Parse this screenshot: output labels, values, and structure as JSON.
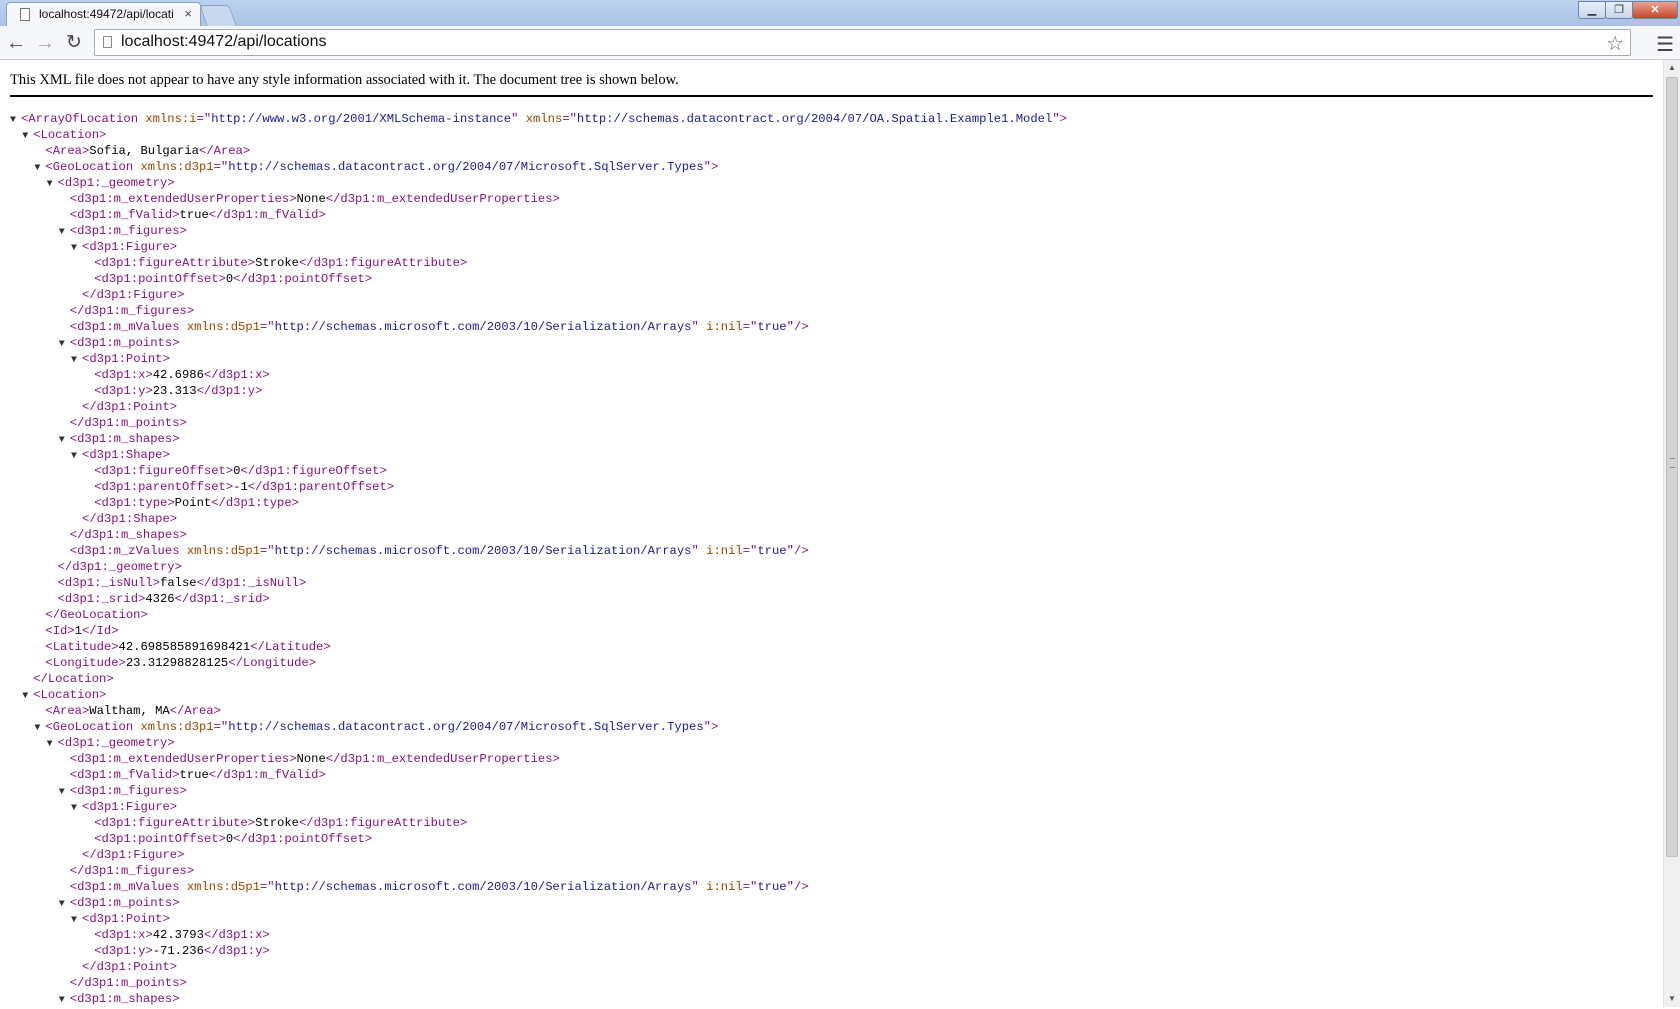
{
  "browser": {
    "tab_title": "localhost:49472/api/locati",
    "tab_close": "×",
    "url": "localhost:49472/api/locations",
    "win_minimize": "▁",
    "win_maximize": "❐",
    "win_close": "✕"
  },
  "content": {
    "info_text": "This XML file does not appear to have any style information associated with it. The document tree is shown below."
  },
  "xml": {
    "rows": [
      {
        "t": "▼",
        "s": [
          [
            "tg",
            "<ArrayOfLocation"
          ],
          [
            "an",
            " xmlns:i"
          ],
          [
            "tg",
            "=\""
          ],
          [
            "av",
            "http://www.w3.org/2001/XMLSchema-instance"
          ],
          [
            "tg",
            "\""
          ],
          [
            "an",
            " xmlns"
          ],
          [
            "tg",
            "=\""
          ],
          [
            "av",
            "http://schemas.datacontract.org/2004/07/OA.Spatial.Example1.Model"
          ],
          [
            "tg",
            "\">"
          ]
        ]
      },
      {
        "t": "▼",
        "s": [
          [
            "tg",
            "<Location>"
          ]
        ]
      },
      {
        "t": "",
        "s": [
          [
            "tg",
            "<Area>"
          ],
          [
            "tx",
            "Sofia, Bulgaria"
          ],
          [
            "tg",
            "</Area>"
          ]
        ]
      },
      {
        "t": "▼",
        "s": [
          [
            "tg",
            "<GeoLocation"
          ],
          [
            "an",
            " xmlns:d3p1"
          ],
          [
            "tg",
            "=\""
          ],
          [
            "av",
            "http://schemas.datacontract.org/2004/07/Microsoft.SqlServer.Types"
          ],
          [
            "tg",
            "\">"
          ]
        ]
      },
      {
        "t": "▼",
        "s": [
          [
            "tg",
            "<d3p1:_geometry>"
          ]
        ]
      },
      {
        "t": "",
        "s": [
          [
            "tg",
            "<d3p1:m_extendedUserProperties>"
          ],
          [
            "tx",
            "None"
          ],
          [
            "tg",
            "</d3p1:m_extendedUserProperties>"
          ]
        ]
      },
      {
        "t": "",
        "s": [
          [
            "tg",
            "<d3p1:m_fValid>"
          ],
          [
            "tx",
            "true"
          ],
          [
            "tg",
            "</d3p1:m_fValid>"
          ]
        ]
      },
      {
        "t": "▼",
        "s": [
          [
            "tg",
            "<d3p1:m_figures>"
          ]
        ]
      },
      {
        "t": "▼",
        "s": [
          [
            "tg",
            "<d3p1:Figure>"
          ]
        ]
      },
      {
        "t": "",
        "s": [
          [
            "tg",
            "<d3p1:figureAttribute>"
          ],
          [
            "tx",
            "Stroke"
          ],
          [
            "tg",
            "</d3p1:figureAttribute>"
          ]
        ]
      },
      {
        "t": "",
        "s": [
          [
            "tg",
            "<d3p1:pointOffset>"
          ],
          [
            "tx",
            "0"
          ],
          [
            "tg",
            "</d3p1:pointOffset>"
          ]
        ]
      },
      {
        "t": "",
        "s": [
          [
            "tg",
            "</d3p1:Figure>"
          ]
        ]
      },
      {
        "t": "",
        "s": [
          [
            "tg",
            "</d3p1:m_figures>"
          ]
        ]
      },
      {
        "t": "",
        "s": [
          [
            "tg",
            "<d3p1:m_mValues"
          ],
          [
            "an",
            " xmlns:d5p1"
          ],
          [
            "tg",
            "=\""
          ],
          [
            "av",
            "http://schemas.microsoft.com/2003/10/Serialization/Arrays"
          ],
          [
            "tg",
            "\""
          ],
          [
            "an",
            " i:nil"
          ],
          [
            "tg",
            "=\""
          ],
          [
            "av",
            "true"
          ],
          [
            "tg",
            "\"/>"
          ]
        ]
      },
      {
        "t": "▼",
        "s": [
          [
            "tg",
            "<d3p1:m_points>"
          ]
        ]
      },
      {
        "t": "▼",
        "s": [
          [
            "tg",
            "<d3p1:Point>"
          ]
        ]
      },
      {
        "t": "",
        "s": [
          [
            "tg",
            "<d3p1:x>"
          ],
          [
            "tx",
            "42.6986"
          ],
          [
            "tg",
            "</d3p1:x>"
          ]
        ]
      },
      {
        "t": "",
        "s": [
          [
            "tg",
            "<d3p1:y>"
          ],
          [
            "tx",
            "23.313"
          ],
          [
            "tg",
            "</d3p1:y>"
          ]
        ]
      },
      {
        "t": "",
        "s": [
          [
            "tg",
            "</d3p1:Point>"
          ]
        ]
      },
      {
        "t": "",
        "s": [
          [
            "tg",
            "</d3p1:m_points>"
          ]
        ]
      },
      {
        "t": "▼",
        "s": [
          [
            "tg",
            "<d3p1:m_shapes>"
          ]
        ]
      },
      {
        "t": "▼",
        "s": [
          [
            "tg",
            "<d3p1:Shape>"
          ]
        ]
      },
      {
        "t": "",
        "s": [
          [
            "tg",
            "<d3p1:figureOffset>"
          ],
          [
            "tx",
            "0"
          ],
          [
            "tg",
            "</d3p1:figureOffset>"
          ]
        ]
      },
      {
        "t": "",
        "s": [
          [
            "tg",
            "<d3p1:parentOffset>"
          ],
          [
            "tx",
            "-1"
          ],
          [
            "tg",
            "</d3p1:parentOffset>"
          ]
        ]
      },
      {
        "t": "",
        "s": [
          [
            "tg",
            "<d3p1:type>"
          ],
          [
            "tx",
            "Point"
          ],
          [
            "tg",
            "</d3p1:type>"
          ]
        ]
      },
      {
        "t": "",
        "s": [
          [
            "tg",
            "</d3p1:Shape>"
          ]
        ]
      },
      {
        "t": "",
        "s": [
          [
            "tg",
            "</d3p1:m_shapes>"
          ]
        ]
      },
      {
        "t": "",
        "s": [
          [
            "tg",
            "<d3p1:m_zValues"
          ],
          [
            "an",
            " xmlns:d5p1"
          ],
          [
            "tg",
            "=\""
          ],
          [
            "av",
            "http://schemas.microsoft.com/2003/10/Serialization/Arrays"
          ],
          [
            "tg",
            "\""
          ],
          [
            "an",
            " i:nil"
          ],
          [
            "tg",
            "=\""
          ],
          [
            "av",
            "true"
          ],
          [
            "tg",
            "\"/>"
          ]
        ]
      },
      {
        "t": "",
        "s": [
          [
            "tg",
            "</d3p1:_geometry>"
          ]
        ]
      },
      {
        "t": "",
        "s": [
          [
            "tg",
            "<d3p1:_isNull>"
          ],
          [
            "tx",
            "false"
          ],
          [
            "tg",
            "</d3p1:_isNull>"
          ]
        ]
      },
      {
        "t": "",
        "s": [
          [
            "tg",
            "<d3p1:_srid>"
          ],
          [
            "tx",
            "4326"
          ],
          [
            "tg",
            "</d3p1:_srid>"
          ]
        ]
      },
      {
        "t": "",
        "s": [
          [
            "tg",
            "</GeoLocation>"
          ]
        ]
      },
      {
        "t": "",
        "s": [
          [
            "tg",
            "<Id>"
          ],
          [
            "tx",
            "1"
          ],
          [
            "tg",
            "</Id>"
          ]
        ]
      },
      {
        "t": "",
        "s": [
          [
            "tg",
            "<Latitude>"
          ],
          [
            "tx",
            "42.698585891698421"
          ],
          [
            "tg",
            "</Latitude>"
          ]
        ]
      },
      {
        "t": "",
        "s": [
          [
            "tg",
            "<Longitude>"
          ],
          [
            "tx",
            "23.31298828125"
          ],
          [
            "tg",
            "</Longitude>"
          ]
        ]
      },
      {
        "t": "",
        "s": [
          [
            "tg",
            "</Location>"
          ]
        ]
      },
      {
        "t": "▼",
        "s": [
          [
            "tg",
            "<Location>"
          ]
        ]
      },
      {
        "t": "",
        "s": [
          [
            "tg",
            "<Area>"
          ],
          [
            "tx",
            "Waltham, MA"
          ],
          [
            "tg",
            "</Area>"
          ]
        ]
      },
      {
        "t": "▼",
        "s": [
          [
            "tg",
            "<GeoLocation"
          ],
          [
            "an",
            " xmlns:d3p1"
          ],
          [
            "tg",
            "=\""
          ],
          [
            "av",
            "http://schemas.datacontract.org/2004/07/Microsoft.SqlServer.Types"
          ],
          [
            "tg",
            "\">"
          ]
        ]
      },
      {
        "t": "▼",
        "s": [
          [
            "tg",
            "<d3p1:_geometry>"
          ]
        ]
      },
      {
        "t": "",
        "s": [
          [
            "tg",
            "<d3p1:m_extendedUserProperties>"
          ],
          [
            "tx",
            "None"
          ],
          [
            "tg",
            "</d3p1:m_extendedUserProperties>"
          ]
        ]
      },
      {
        "t": "",
        "s": [
          [
            "tg",
            "<d3p1:m_fValid>"
          ],
          [
            "tx",
            "true"
          ],
          [
            "tg",
            "</d3p1:m_fValid>"
          ]
        ]
      },
      {
        "t": "▼",
        "s": [
          [
            "tg",
            "<d3p1:m_figures>"
          ]
        ]
      },
      {
        "t": "▼",
        "s": [
          [
            "tg",
            "<d3p1:Figure>"
          ]
        ]
      },
      {
        "t": "",
        "s": [
          [
            "tg",
            "<d3p1:figureAttribute>"
          ],
          [
            "tx",
            "Stroke"
          ],
          [
            "tg",
            "</d3p1:figureAttribute>"
          ]
        ]
      },
      {
        "t": "",
        "s": [
          [
            "tg",
            "<d3p1:pointOffset>"
          ],
          [
            "tx",
            "0"
          ],
          [
            "tg",
            "</d3p1:pointOffset>"
          ]
        ]
      },
      {
        "t": "",
        "s": [
          [
            "tg",
            "</d3p1:Figure>"
          ]
        ]
      },
      {
        "t": "",
        "s": [
          [
            "tg",
            "</d3p1:m_figures>"
          ]
        ]
      },
      {
        "t": "",
        "s": [
          [
            "tg",
            "<d3p1:m_mValues"
          ],
          [
            "an",
            " xmlns:d5p1"
          ],
          [
            "tg",
            "=\""
          ],
          [
            "av",
            "http://schemas.microsoft.com/2003/10/Serialization/Arrays"
          ],
          [
            "tg",
            "\""
          ],
          [
            "an",
            " i:nil"
          ],
          [
            "tg",
            "=\""
          ],
          [
            "av",
            "true"
          ],
          [
            "tg",
            "\"/>"
          ]
        ]
      },
      {
        "t": "▼",
        "s": [
          [
            "tg",
            "<d3p1:m_points>"
          ]
        ]
      },
      {
        "t": "▼",
        "s": [
          [
            "tg",
            "<d3p1:Point>"
          ]
        ]
      },
      {
        "t": "",
        "s": [
          [
            "tg",
            "<d3p1:x>"
          ],
          [
            "tx",
            "42.3793"
          ],
          [
            "tg",
            "</d3p1:x>"
          ]
        ]
      },
      {
        "t": "",
        "s": [
          [
            "tg",
            "<d3p1:y>"
          ],
          [
            "tx",
            "-71.236"
          ],
          [
            "tg",
            "</d3p1:y>"
          ]
        ]
      },
      {
        "t": "",
        "s": [
          [
            "tg",
            "</d3p1:Point>"
          ]
        ]
      },
      {
        "t": "",
        "s": [
          [
            "tg",
            "</d3p1:m_points>"
          ]
        ]
      },
      {
        "t": "▼",
        "s": [
          [
            "tg",
            "<d3p1:m_shapes>"
          ]
        ]
      }
    ]
  },
  "colors": {
    "tag": "#881280",
    "attribute_name": "#994500",
    "attribute_value": "#1a1aa6",
    "text": "#000000"
  }
}
